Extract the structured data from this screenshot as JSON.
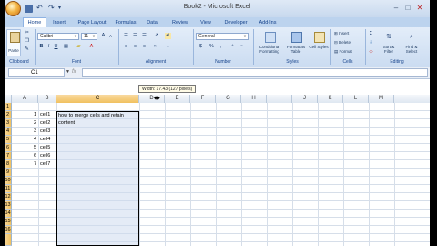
{
  "window": {
    "title": "Book2 - Microsoft Excel",
    "controls": {
      "minimize": "–",
      "maximize": "□",
      "close": "✕"
    }
  },
  "quick_access": {
    "undo_icon": "↶",
    "redo_icon": "↷",
    "dropdown_icon": "▾"
  },
  "tabs": [
    "Home",
    "Insert",
    "Page Layout",
    "Formulas",
    "Data",
    "Review",
    "View",
    "Developer",
    "Add-Ins"
  ],
  "active_tab": "Home",
  "ribbon": {
    "clipboard": {
      "label": "Clipboard",
      "paste": "Paste"
    },
    "font": {
      "label": "Font",
      "font_name": "Calibri",
      "font_size": "11",
      "bold": "B",
      "italic": "I",
      "underline": "U"
    },
    "alignment": {
      "label": "Alignment"
    },
    "number": {
      "label": "Number",
      "format": "General",
      "currency": "$",
      "percent": "%",
      "comma": ","
    },
    "styles": {
      "label": "Styles",
      "conditional": "Conditional Formatting",
      "format_table": "Format as Table",
      "cell_styles": "Cell Styles"
    },
    "cells": {
      "label": "Cells",
      "insert": "Insert",
      "delete": "Delete",
      "format": "Format"
    },
    "editing": {
      "label": "Editing",
      "sum_icon": "Σ",
      "sort": "Sort & Filter",
      "find": "Find & Select"
    }
  },
  "formula_bar": {
    "name_box": "C1",
    "fx": "fx",
    "value": ""
  },
  "tooltip": "Width: 17.43 (127 pixels)",
  "columns": [
    "A",
    "B",
    "C",
    "D",
    "E",
    "F",
    "G",
    "H",
    "I",
    "J",
    "K",
    "L",
    "M"
  ],
  "selected_column": "C",
  "rows": [
    "1",
    "2",
    "3",
    "4",
    "5",
    "6",
    "7",
    "8",
    "9",
    "10",
    "11",
    "12",
    "13",
    "14",
    "15",
    "16"
  ],
  "cells_A": [
    "",
    "1",
    "2",
    "3",
    "4",
    "5",
    "6",
    "7"
  ],
  "cells_B": [
    "",
    "cell1",
    "cell2",
    "cell3",
    "cell4",
    "cell5",
    "cell6",
    "cell7"
  ],
  "cells_C2": {
    "line1": "how to merge cells and retain",
    "line2": "content"
  },
  "accent": "#f1c15f",
  "ribbon_color": "#cbdcf1"
}
